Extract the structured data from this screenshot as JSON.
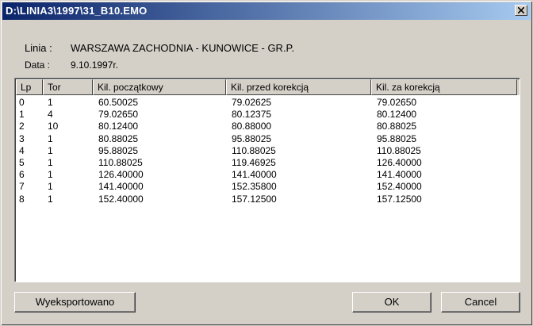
{
  "window": {
    "title": "D:\\LINIA3\\1997\\31_B10.EMO"
  },
  "info": {
    "line_label": "Linia :",
    "line_value": "WARSZAWA ZACHODNIA - KUNOWICE - GR.P.",
    "date_label": "Data :",
    "date_value": "9.10.1997r."
  },
  "table": {
    "columns": [
      "Lp",
      "Tor",
      "Kil. początkowy",
      "Kil. przed korekcją",
      "Kil. za korekcją"
    ],
    "rows": [
      [
        "0",
        "1",
        "60.50025",
        "79.02625",
        "79.02650"
      ],
      [
        "1",
        "4",
        "79.02650",
        "80.12375",
        "80.12400"
      ],
      [
        "2",
        "10",
        "80.12400",
        "80.88000",
        "80.88025"
      ],
      [
        "3",
        "1",
        "80.88025",
        "95.88025",
        "95.88025"
      ],
      [
        "4",
        "1",
        "95.88025",
        "110.88025",
        "110.88025"
      ],
      [
        "5",
        "1",
        "110.88025",
        "119.46925",
        "126.40000"
      ],
      [
        "6",
        "1",
        "126.40000",
        "141.40000",
        "141.40000"
      ],
      [
        "7",
        "1",
        "141.40000",
        "152.35800",
        "152.40000"
      ],
      [
        "8",
        "1",
        "152.40000",
        "157.12500",
        "157.12500"
      ]
    ]
  },
  "buttons": {
    "export": "Wyeksportowano",
    "ok": "OK",
    "cancel": "Cancel"
  },
  "icons": {
    "close": "close-icon"
  }
}
